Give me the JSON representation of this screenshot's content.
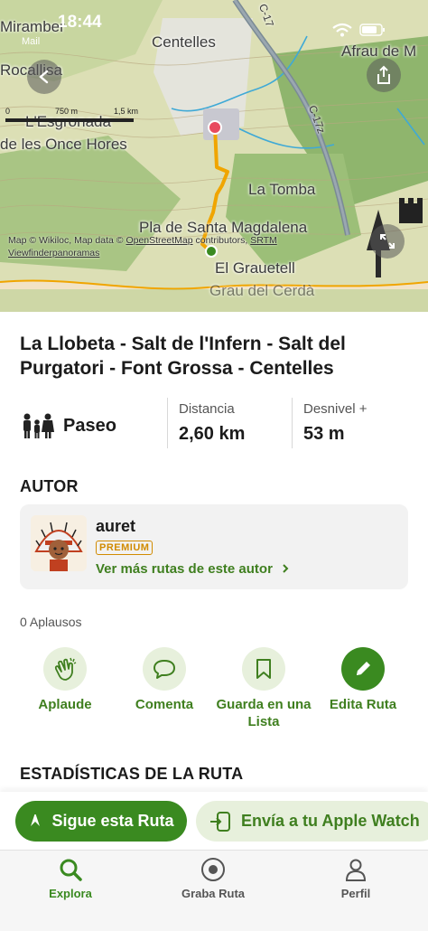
{
  "status": {
    "time": "18:44",
    "back_app": "Mail"
  },
  "map": {
    "places": [
      "Miramber",
      "Centelles",
      "Afrau de M",
      "Rocallisa",
      "L'Esgronada",
      "de les Once Hores",
      "La Tomba",
      "Pla de Santa Magdalena",
      "El Grauetell",
      "Grau del Cerdà",
      "C-17",
      "C-17z"
    ],
    "scale_labels": [
      "0",
      "750 m",
      "1,5 km"
    ],
    "attribution_prefix": "Map © Wikiloc, Map data © ",
    "attribution_osm": "OpenStreetMap",
    "attribution_mid": " contributors, ",
    "attribution_srtm": "SRTM",
    "attribution_line2": "Viewfinderpanoramas"
  },
  "route": {
    "title": "La Llobeta - Salt de l'Infern - Salt del Purgatori - Font Grossa - Centelles",
    "activity": "Paseo",
    "distance_label": "Distancia",
    "distance_value": "2,60 km",
    "elevation_label": "Desnivel +",
    "elevation_value": "53 m"
  },
  "author": {
    "section_title": "AUTOR",
    "name": "auret",
    "badge": "PREMIUM",
    "more_link": "Ver más rutas de este autor"
  },
  "social": {
    "applause_count": "0 Aplausos",
    "actions": [
      {
        "label": "Aplaude",
        "icon": "clap-icon"
      },
      {
        "label": "Comenta",
        "icon": "comment-icon"
      },
      {
        "label": "Guarda en una Lista",
        "icon": "bookmark-icon"
      },
      {
        "label": "Edita Ruta",
        "icon": "pencil-icon"
      }
    ]
  },
  "stats_section_title": "ESTADÍSTICAS DE LA RUTA",
  "cta": {
    "follow": "Sigue esta Ruta",
    "watch": "Envía a tu Apple Watch"
  },
  "tabs": [
    {
      "label": "Explora",
      "icon": "search-icon",
      "active": true
    },
    {
      "label": "Graba Ruta",
      "icon": "record-icon",
      "active": false
    },
    {
      "label": "Perfil",
      "icon": "profile-icon",
      "active": false
    }
  ],
  "colors": {
    "accent": "#3a8a20",
    "accent_light": "#e7f0dc",
    "route": "#f0a500",
    "premium": "#d18b00"
  }
}
